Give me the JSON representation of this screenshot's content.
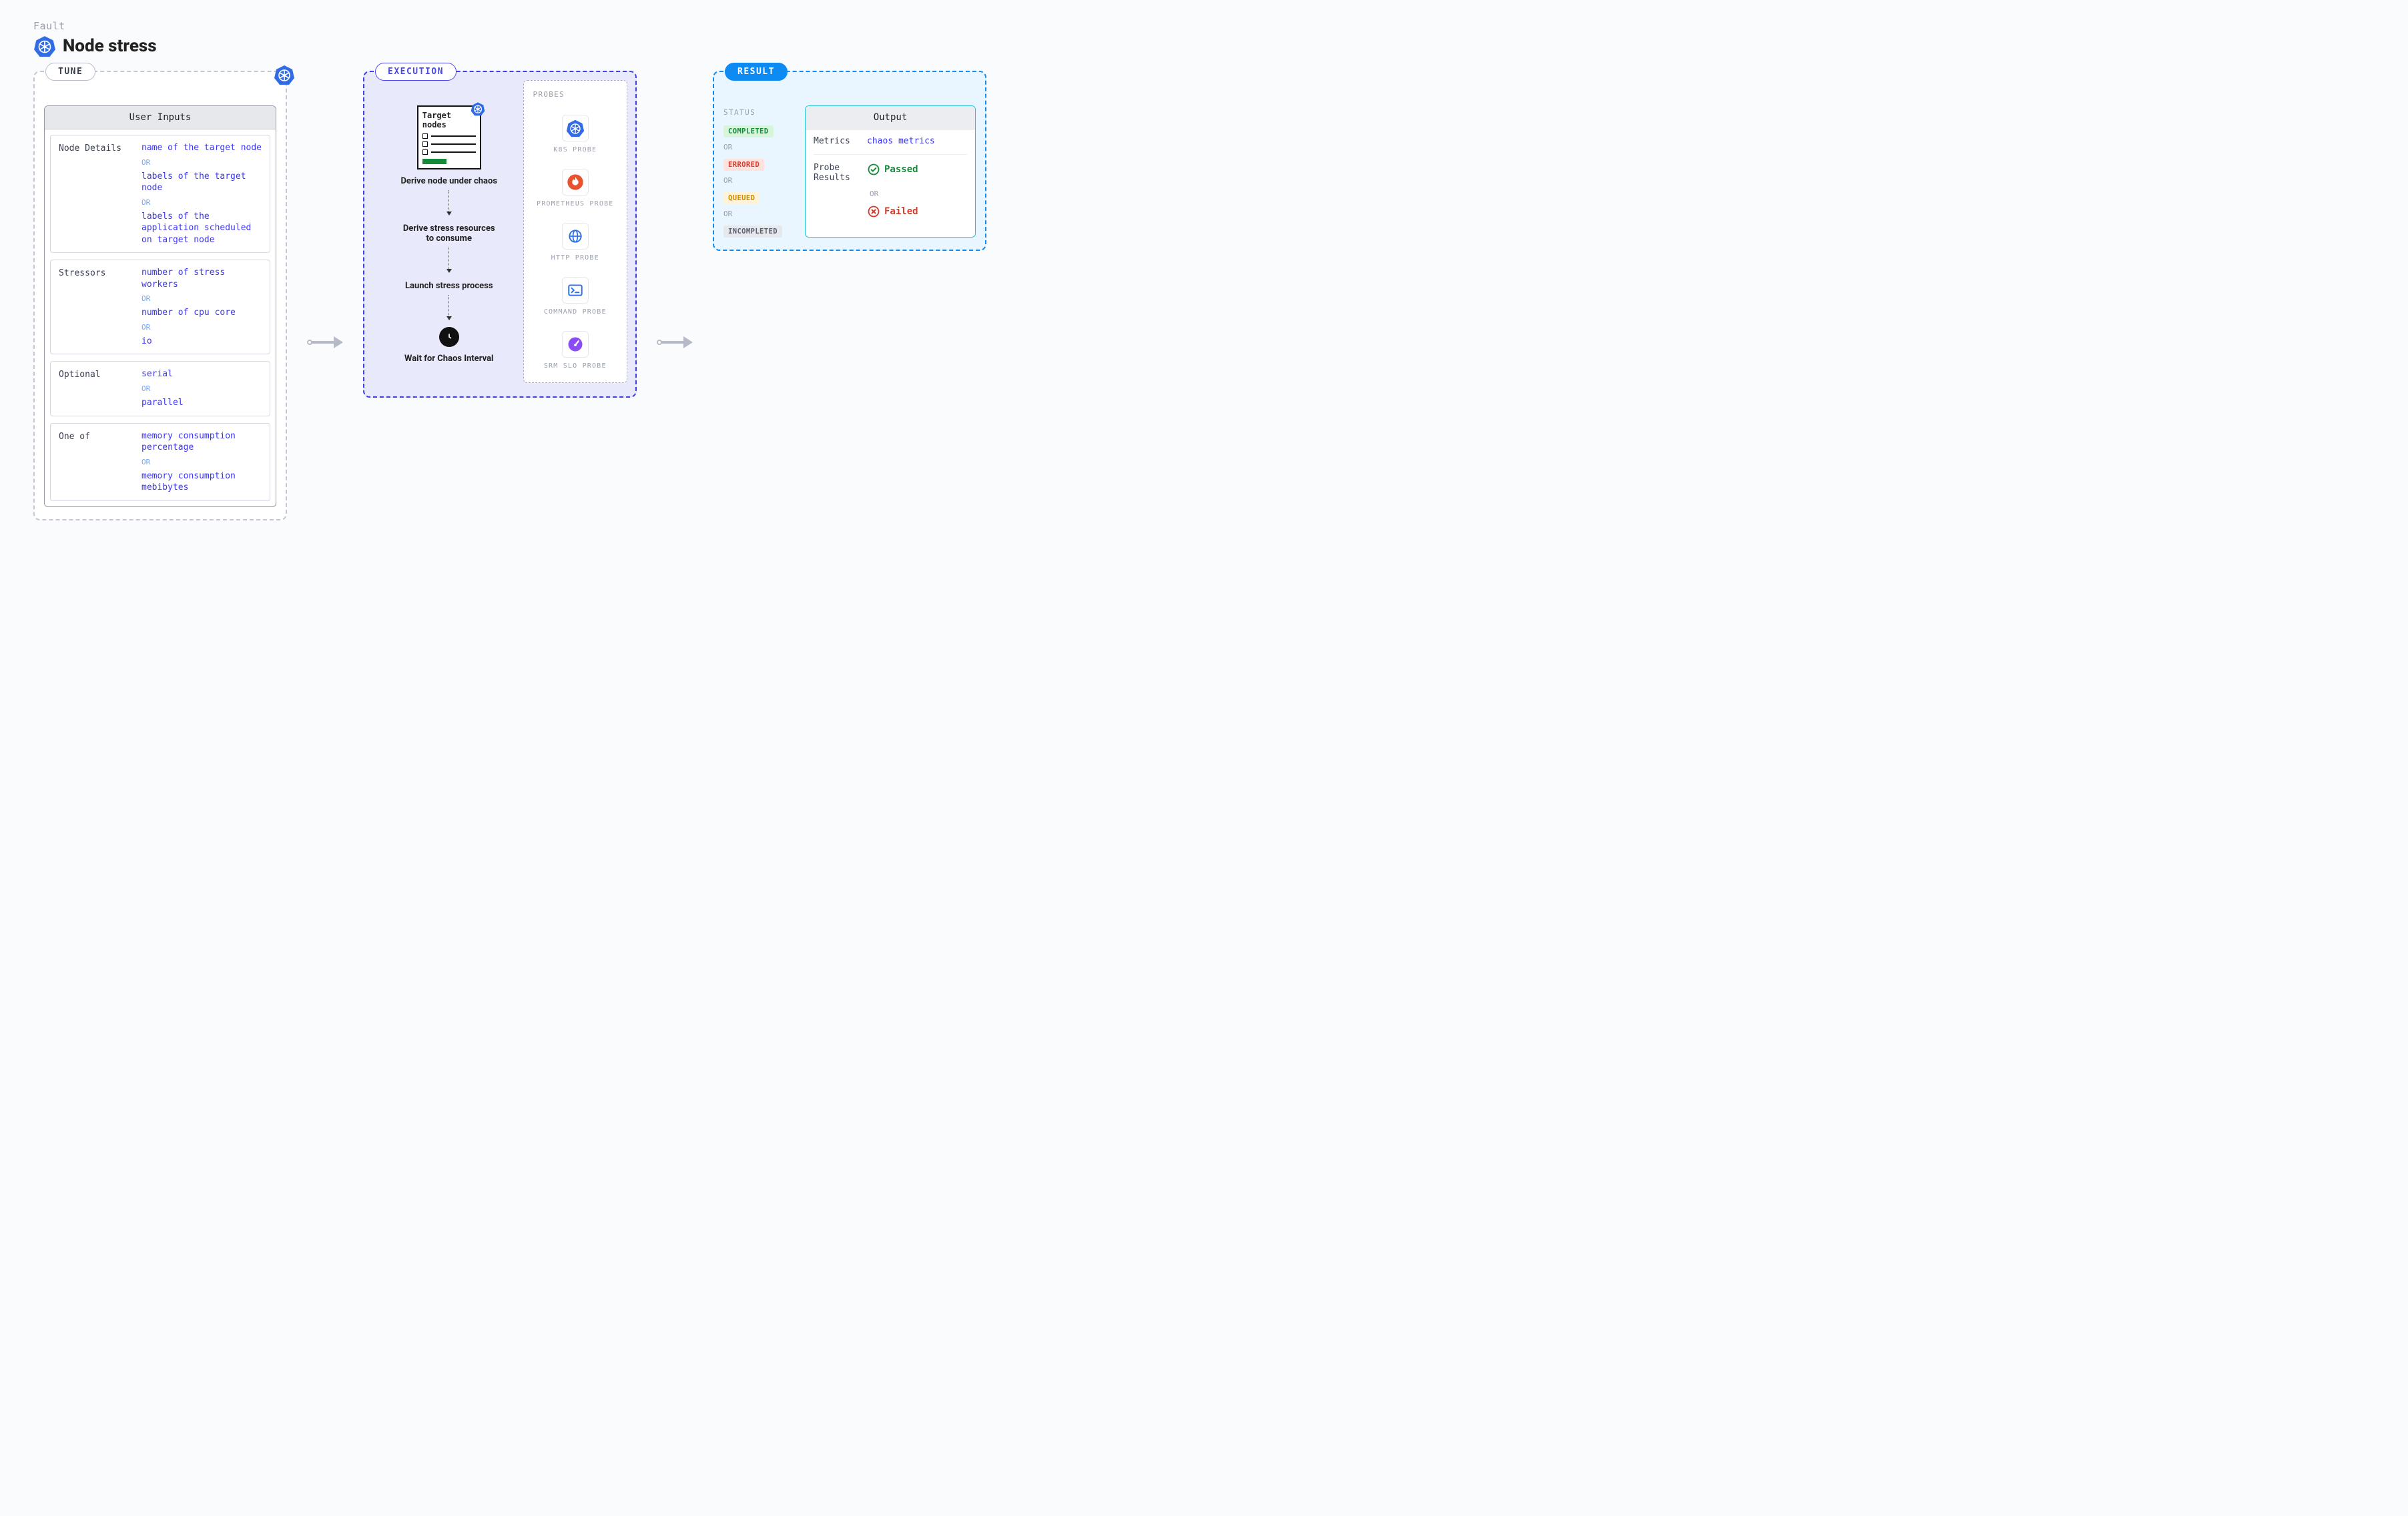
{
  "header": {
    "eyebrow": "Fault",
    "title": "Node stress",
    "icon": "kubernetes-icon"
  },
  "tune": {
    "tab": "TUNE",
    "card_title": "User Inputs",
    "separator": "OR",
    "sections": [
      {
        "label": "Node Details",
        "options": [
          "name of the target node",
          "labels of the target node",
          "labels of the application scheduled on target node"
        ]
      },
      {
        "label": "Stressors",
        "options": [
          "number of stress workers",
          "number of cpu core",
          "io"
        ]
      },
      {
        "label": "Optional",
        "options": [
          "serial",
          "parallel"
        ]
      },
      {
        "label": "One of",
        "options": [
          "memory consumption percentage",
          "memory consumption mebibytes"
        ]
      }
    ]
  },
  "execution": {
    "tab": "EXECUTION",
    "target_box_title": "Target nodes",
    "steps": [
      "Derive node under chaos",
      "Derive stress resources to consume",
      "Launch stress process",
      "Wait for Chaos Interval"
    ],
    "clock_icon": "clock-icon",
    "probes_header": "PROBES",
    "probes": [
      {
        "icon": "kubernetes-icon",
        "label": "K8S PROBE"
      },
      {
        "icon": "prometheus-icon",
        "label": "PROMETHEUS PROBE"
      },
      {
        "icon": "http-icon",
        "label": "HTTP PROBE"
      },
      {
        "icon": "command-icon",
        "label": "COMMAND PROBE"
      },
      {
        "icon": "srm-slo-icon",
        "label": "SRM SLO PROBE"
      }
    ]
  },
  "result": {
    "tab": "RESULT",
    "status_header": "STATUS",
    "separator": "OR",
    "statuses": [
      {
        "text": "COMPLETED",
        "cls": "b-completed"
      },
      {
        "text": "ERRORED",
        "cls": "b-errored"
      },
      {
        "text": "QUEUED",
        "cls": "b-queued"
      },
      {
        "text": "INCOMPLETED",
        "cls": "b-incompleted"
      }
    ],
    "output_title": "Output",
    "metrics_label": "Metrics",
    "metrics_value": "chaos metrics",
    "probe_results_label": "Probe Results",
    "passed": "Passed",
    "failed": "Failed"
  }
}
